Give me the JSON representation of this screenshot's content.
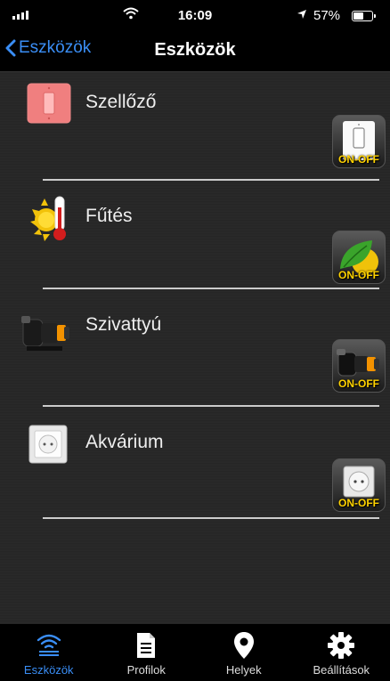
{
  "status_bar": {
    "time": "16:09",
    "battery_percent": "57%",
    "battery_level": 0.57
  },
  "nav": {
    "back_label": "Eszközök",
    "title": "Eszközök"
  },
  "devices": [
    {
      "label": "Szellőző",
      "icon": "wall-switch-icon",
      "toggle_text": "ON-OFF"
    },
    {
      "label": "Fűtés",
      "icon": "sun-thermometer-icon",
      "toggle_text": "ON-OFF"
    },
    {
      "label": "Szivattyú",
      "icon": "water-pump-icon",
      "toggle_text": "ON-OFF"
    },
    {
      "label": "Akvárium",
      "icon": "power-socket-icon",
      "toggle_text": "ON-OFF"
    }
  ],
  "tabs": [
    {
      "label": "Eszközök",
      "icon": "wifi-icon",
      "active": true
    },
    {
      "label": "Profilok",
      "icon": "document-icon",
      "active": false
    },
    {
      "label": "Helyek",
      "icon": "map-pin-icon",
      "active": false
    },
    {
      "label": "Beállítások",
      "icon": "gear-icon",
      "active": false
    }
  ],
  "colors": {
    "accent": "#3a8ef6",
    "toggle_text": "#ffd200"
  }
}
